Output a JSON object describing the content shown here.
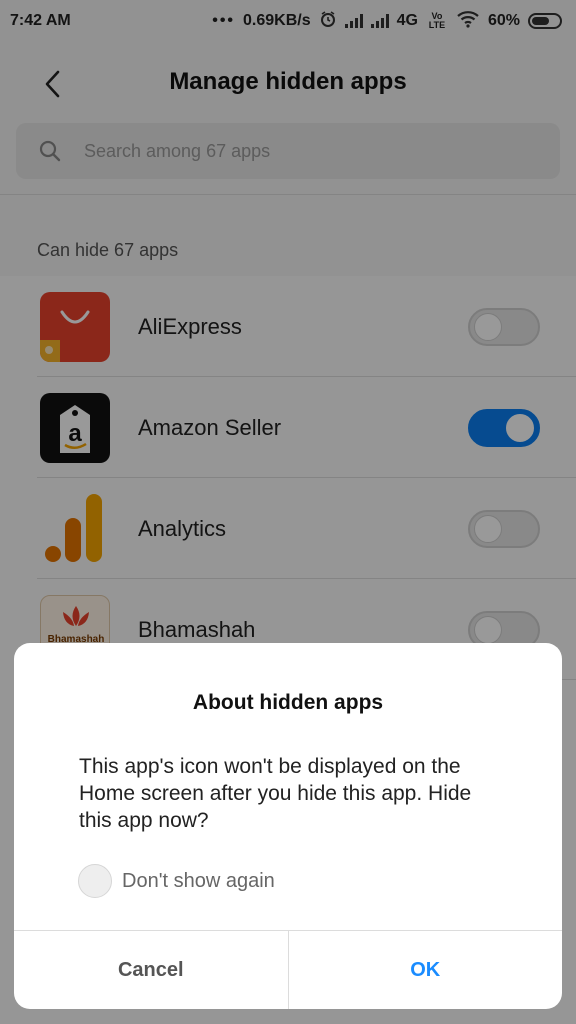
{
  "status_bar": {
    "time": "7:42 AM",
    "dots": "•••",
    "speed": "0.69KB/s",
    "network": "4G",
    "volte": "Vo LTE",
    "battery": "60%"
  },
  "header": {
    "title": "Manage hidden apps",
    "back_icon": "chevron-left-icon"
  },
  "search": {
    "placeholder": "Search among 67 apps",
    "icon": "search-icon"
  },
  "section": {
    "label": "Can hide 67 apps"
  },
  "apps": [
    {
      "name": "AliExpress",
      "icon_text": "AliExpress",
      "hidden": false
    },
    {
      "name": "Amazon Seller",
      "icon_text": "a",
      "hidden": true
    },
    {
      "name": "Analytics",
      "icon_text": "",
      "hidden": false
    },
    {
      "name": "Bhamashah",
      "icon_text": "Bhamashah",
      "hidden": false
    }
  ],
  "dialog": {
    "title": "About hidden apps",
    "message": "This app's icon won't be displayed on the Home screen after you hide this app. Hide this app now?",
    "checkbox_label": "Don't show again",
    "cancel_label": "Cancel",
    "ok_label": "OK"
  },
  "colors": {
    "accent": "#0a7ef0",
    "ok_text": "#1a8cff",
    "aliexpress": "#e8412c",
    "analytics_orange": "#f4a300"
  }
}
